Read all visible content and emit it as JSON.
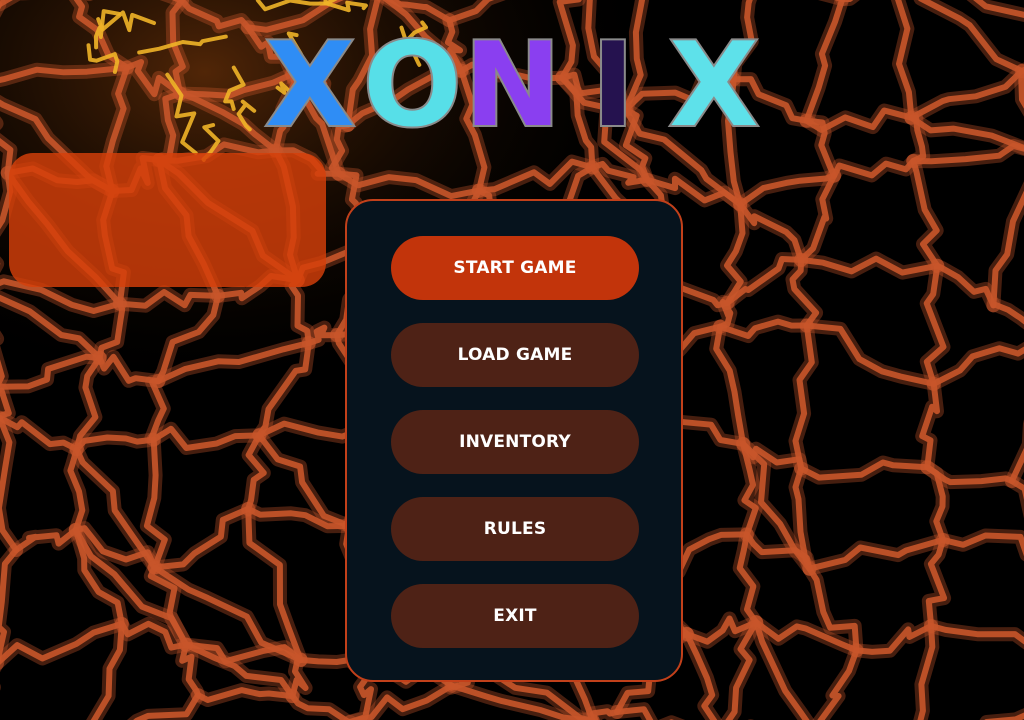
{
  "title": {
    "letters": [
      {
        "char": "X",
        "color": "#2f8df5"
      },
      {
        "char": "O",
        "color": "#57dfe8"
      },
      {
        "char": "N",
        "color": "#8a3ff0"
      },
      {
        "char": "I",
        "color": "#25124f"
      },
      {
        "char": "X",
        "color": "#5ee1ea"
      }
    ]
  },
  "menu": {
    "buttons": [
      {
        "label": "START GAME",
        "active": true
      },
      {
        "label": "LOAD GAME",
        "active": false
      },
      {
        "label": "INVENTORY",
        "active": false
      },
      {
        "label": "RULES",
        "active": false
      },
      {
        "label": "EXIT",
        "active": false
      }
    ]
  },
  "colors": {
    "background": "#000000",
    "lava_crack": "#c8552a",
    "lava_glow": "#f0b428",
    "info_panel": "#d6400a",
    "menu_panel": "#06131d",
    "menu_border": "#c2401a",
    "button_active": "#c2340b",
    "button_default": "#4e2216",
    "button_text": "#ffffff",
    "title_outline": "#8a8a8a"
  }
}
